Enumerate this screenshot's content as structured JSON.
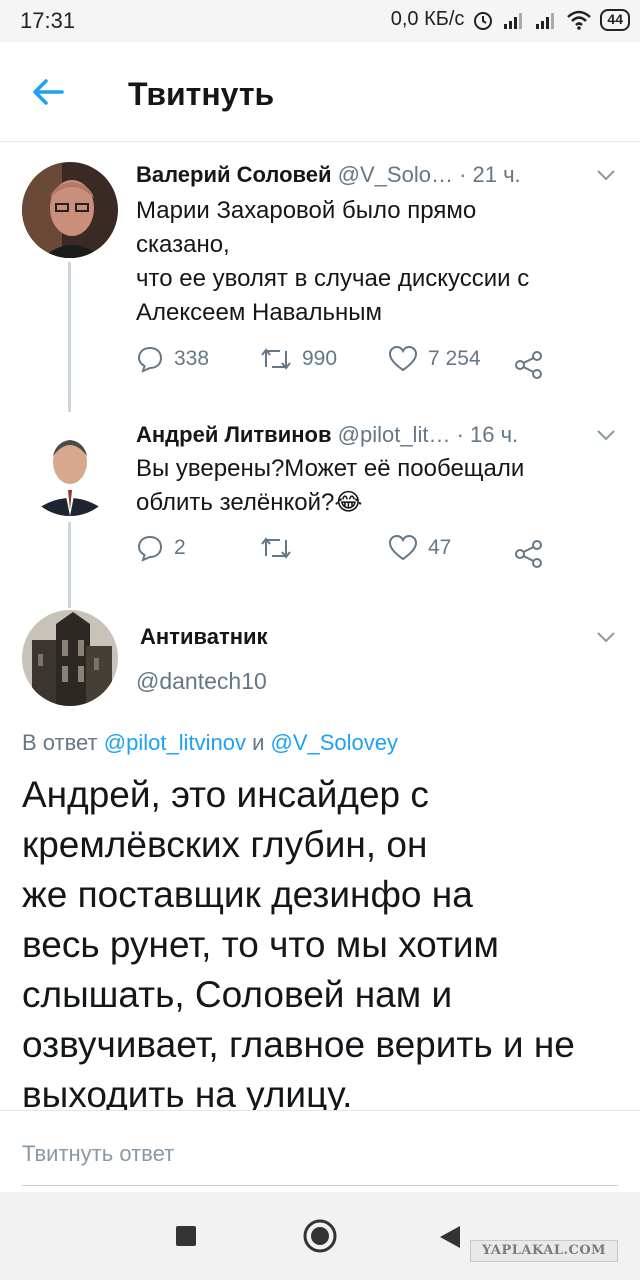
{
  "status_bar": {
    "time": "17:31",
    "network_speed": "0,0 КБ/с",
    "battery": "44",
    "icons": [
      "alarm-icon",
      "signal-icon",
      "signal-icon",
      "wifi-icon",
      "battery-icon"
    ]
  },
  "header": {
    "title": "Твитнуть",
    "back_icon": "arrow-left-icon"
  },
  "tweets": [
    {
      "name": "Валерий Соловей",
      "handle": "@V_Solo…",
      "time": "· 21 ч.",
      "text": [
        "Марии Захаровой было прямо",
        "сказано,",
        "что ее уволят в случае дискуссии с",
        "Алексеем Навальным"
      ],
      "replies": "338",
      "retweets": "990",
      "likes": "7 254"
    },
    {
      "name": "Андрей Литвинов",
      "handle": "@pilot_lit…",
      "time": "· 16 ч.",
      "text": [
        "Вы уверены?Может её пообещали",
        "облить зелёнкой?😂"
      ],
      "replies": "2",
      "retweets": "",
      "likes": "47"
    }
  ],
  "main_tweet": {
    "name": "Антиватник",
    "handle": "@dantech10",
    "reply_prefix": "В ответ",
    "reply_user1": "@pilot_litvinov",
    "reply_and": "и",
    "reply_user2": "@V_Solovey",
    "text": [
      "Андрей, это инсайдер с",
      "кремлёвских глубин, он",
      "же поставщик дезинфо на",
      "весь рунет, то что мы хотим",
      "слышать, Соловей нам и",
      "озвучивает, главное верить и не",
      "выходить на улицу."
    ]
  },
  "reply_box": {
    "placeholder": "Твитнуть ответ"
  },
  "watermark": "YAPLAKAL.COM",
  "colors": {
    "accent": "#1da1f2",
    "muted": "#657786",
    "text": "#14171a",
    "divider": "#e1e8ed"
  }
}
